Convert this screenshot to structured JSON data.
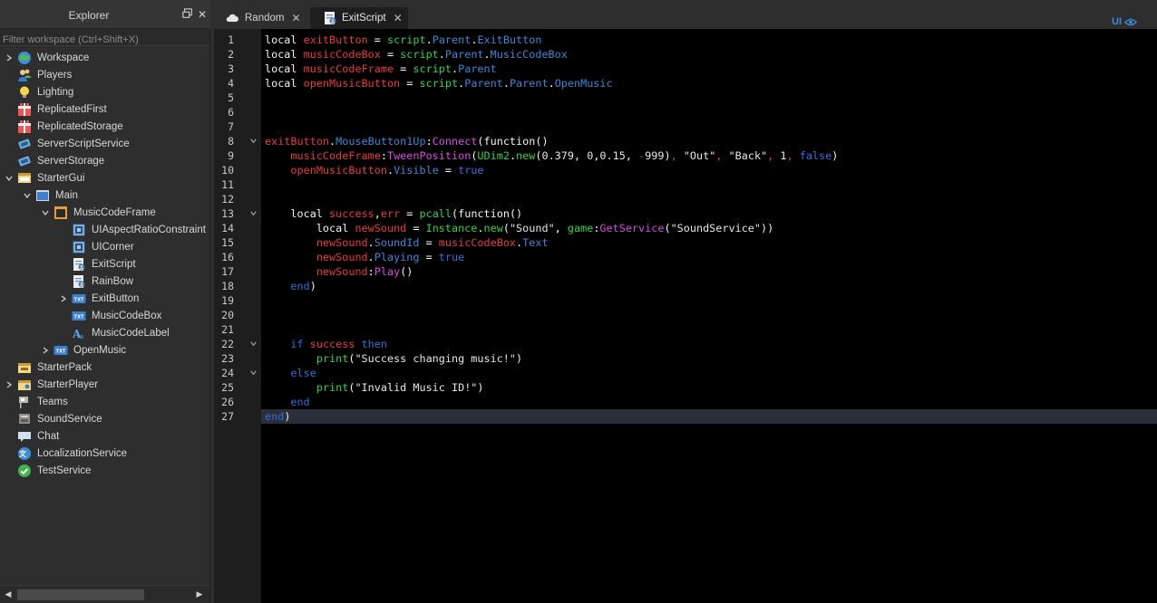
{
  "explorer": {
    "title": "Explorer",
    "filter_placeholder": "Filter workspace (Ctrl+Shift+X)",
    "nodes": [
      {
        "label": "Workspace",
        "icon": "workspace-icon",
        "has_chevron": true,
        "expanded": false
      },
      {
        "label": "Players",
        "icon": "players-icon"
      },
      {
        "label": "Lighting",
        "icon": "lightbulb-icon"
      },
      {
        "label": "ReplicatedFirst",
        "icon": "replicated-first-icon"
      },
      {
        "label": "ReplicatedStorage",
        "icon": "replicated-storage-icon"
      },
      {
        "label": "ServerScriptService",
        "icon": "server-script-service-icon"
      },
      {
        "label": "ServerStorage",
        "icon": "server-storage-icon"
      },
      {
        "label": "StarterGui",
        "icon": "starter-gui-icon",
        "has_chevron": true,
        "expanded": true
      },
      {
        "label": "Main",
        "icon": "screen-gui-icon",
        "has_chevron": true,
        "expanded": true
      },
      {
        "label": "MusicCodeFrame",
        "icon": "frame-icon",
        "has_chevron": true,
        "expanded": true
      },
      {
        "label": "UIAspectRatioConstraint",
        "icon": "ui-component-icon"
      },
      {
        "label": "UICorner",
        "icon": "ui-component-icon"
      },
      {
        "label": "ExitScript",
        "icon": "local-script-icon"
      },
      {
        "label": "RainBow",
        "icon": "local-script-icon"
      },
      {
        "label": "ExitButton",
        "icon": "text-button-icon",
        "has_chevron": true,
        "expanded": false
      },
      {
        "label": "MusicCodeBox",
        "icon": "text-box-icon"
      },
      {
        "label": "MusicCodeLabel",
        "icon": "text-label-icon"
      },
      {
        "label": "OpenMusic",
        "icon": "text-button-icon",
        "has_chevron": true,
        "expanded": false
      },
      {
        "label": "StarterPack",
        "icon": "starter-pack-icon"
      },
      {
        "label": "StarterPlayer",
        "icon": "starter-player-icon",
        "has_chevron": true,
        "expanded": false
      },
      {
        "label": "Teams",
        "icon": "teams-icon"
      },
      {
        "label": "SoundService",
        "icon": "sound-service-icon"
      },
      {
        "label": "Chat",
        "icon": "chat-icon"
      },
      {
        "label": "LocalizationService",
        "icon": "localization-icon"
      },
      {
        "label": "TestService",
        "icon": "check-icon"
      }
    ]
  },
  "tabs": [
    {
      "label": "Random",
      "icon": "cloud-icon",
      "active": false
    },
    {
      "label": "ExitScript",
      "icon": "local-script-icon",
      "active": true
    }
  ],
  "ui_toggle": {
    "label": "UI"
  },
  "editor": {
    "current_line": 27,
    "lines": [
      {
        "n": "1",
        "fold": false,
        "tokens": [
          [
            "kw",
            "local "
          ],
          [
            "var",
            "exitButton"
          ],
          [
            "tok-o",
            " = "
          ],
          [
            "gl",
            "script"
          ],
          [
            "tok-o",
            "."
          ],
          [
            "prop",
            "Parent"
          ],
          [
            "tok-o",
            "."
          ],
          [
            "prop",
            "ExitButton"
          ]
        ]
      },
      {
        "n": "2",
        "fold": false,
        "tokens": [
          [
            "kw",
            "local "
          ],
          [
            "var",
            "musicCodeBox"
          ],
          [
            "tok-o",
            " = "
          ],
          [
            "gl",
            "script"
          ],
          [
            "tok-o",
            "."
          ],
          [
            "prop",
            "Parent"
          ],
          [
            "tok-o",
            "."
          ],
          [
            "prop",
            "MusicCodeBox"
          ]
        ]
      },
      {
        "n": "3",
        "fold": false,
        "tokens": [
          [
            "kw",
            "local "
          ],
          [
            "var",
            "musicCodeFrame"
          ],
          [
            "tok-o",
            " = "
          ],
          [
            "gl",
            "script"
          ],
          [
            "tok-o",
            "."
          ],
          [
            "prop",
            "Parent"
          ]
        ]
      },
      {
        "n": "4",
        "fold": false,
        "tokens": [
          [
            "kw",
            "local "
          ],
          [
            "var",
            "openMusicButton"
          ],
          [
            "tok-o",
            " = "
          ],
          [
            "gl",
            "script"
          ],
          [
            "tok-o",
            "."
          ],
          [
            "prop",
            "Parent"
          ],
          [
            "tok-o",
            "."
          ],
          [
            "prop",
            "Parent"
          ],
          [
            "tok-o",
            "."
          ],
          [
            "prop",
            "OpenMusic"
          ]
        ]
      },
      {
        "n": "5",
        "fold": false,
        "tokens": []
      },
      {
        "n": "6",
        "fold": false,
        "tokens": []
      },
      {
        "n": "7",
        "fold": false,
        "tokens": []
      },
      {
        "n": "8",
        "fold": true,
        "tokens": [
          [
            "var",
            "exitButton"
          ],
          [
            "tok-o",
            "."
          ],
          [
            "prop",
            "MouseButton1Up"
          ],
          [
            "tok-o",
            ":"
          ],
          [
            "fn",
            "Connect"
          ],
          [
            "kw",
            "("
          ],
          [
            "kw",
            "function"
          ],
          [
            "kw",
            "()"
          ]
        ]
      },
      {
        "n": "9",
        "fold": false,
        "tokens": [
          [
            "tok-o",
            "    "
          ],
          [
            "var",
            "musicCodeFrame"
          ],
          [
            "tok-o",
            ":"
          ],
          [
            "fn",
            "TweenPosition"
          ],
          [
            "kw",
            "("
          ],
          [
            "gl",
            "UDim2"
          ],
          [
            "tok-o",
            "."
          ],
          [
            "gl",
            "new"
          ],
          [
            "kw",
            "("
          ],
          [
            "num",
            "0.379"
          ],
          [
            "tok-o",
            ", "
          ],
          [
            "num",
            "0"
          ],
          [
            "tok-o",
            ","
          ],
          [
            "num",
            "0.15"
          ],
          [
            "tok-o",
            ", "
          ],
          [
            "var",
            "-"
          ],
          [
            "num",
            "999"
          ],
          [
            "kw",
            ")"
          ],
          [
            "var",
            ", "
          ],
          [
            "str",
            "\"Out\""
          ],
          [
            "var",
            ", "
          ],
          [
            "str",
            "\"Back\""
          ],
          [
            "var",
            ", "
          ],
          [
            "num",
            "1"
          ],
          [
            "var",
            ", "
          ],
          [
            "bool",
            "false"
          ],
          [
            "kw",
            ")"
          ]
        ]
      },
      {
        "n": "10",
        "fold": false,
        "tokens": [
          [
            "tok-o",
            "    "
          ],
          [
            "var",
            "openMusicButton"
          ],
          [
            "tok-o",
            "."
          ],
          [
            "prop",
            "Visible"
          ],
          [
            "tok-o",
            " = "
          ],
          [
            "bool",
            "true"
          ]
        ]
      },
      {
        "n": "11",
        "fold": false,
        "tokens": []
      },
      {
        "n": "12",
        "fold": false,
        "tokens": []
      },
      {
        "n": "13",
        "fold": true,
        "tokens": [
          [
            "tok-o",
            "    "
          ],
          [
            "kw",
            "local "
          ],
          [
            "var",
            "success"
          ],
          [
            "tok-o",
            ","
          ],
          [
            "var",
            "err"
          ],
          [
            "tok-o",
            " = "
          ],
          [
            "gl",
            "pcall"
          ],
          [
            "kw",
            "("
          ],
          [
            "kw",
            "function"
          ],
          [
            "kw",
            "()"
          ]
        ]
      },
      {
        "n": "14",
        "fold": false,
        "tokens": [
          [
            "tok-o",
            "        "
          ],
          [
            "kw",
            "local "
          ],
          [
            "var",
            "newSound"
          ],
          [
            "tok-o",
            " = "
          ],
          [
            "gl",
            "Instance"
          ],
          [
            "tok-o",
            "."
          ],
          [
            "gl",
            "new"
          ],
          [
            "kw",
            "("
          ],
          [
            "str",
            "\"Sound\""
          ],
          [
            "tok-o",
            ", "
          ],
          [
            "gl",
            "game"
          ],
          [
            "tok-o",
            ":"
          ],
          [
            "fn",
            "GetService"
          ],
          [
            "kw",
            "("
          ],
          [
            "str",
            "\"SoundService\""
          ],
          [
            "kw",
            "))"
          ]
        ]
      },
      {
        "n": "15",
        "fold": false,
        "tokens": [
          [
            "tok-o",
            "        "
          ],
          [
            "var",
            "newSound"
          ],
          [
            "tok-o",
            "."
          ],
          [
            "prop",
            "SoundId"
          ],
          [
            "tok-o",
            " = "
          ],
          [
            "var",
            "musicCodeBox"
          ],
          [
            "tok-o",
            "."
          ],
          [
            "prop",
            "Text"
          ]
        ]
      },
      {
        "n": "16",
        "fold": false,
        "tokens": [
          [
            "tok-o",
            "        "
          ],
          [
            "var",
            "newSound"
          ],
          [
            "tok-o",
            "."
          ],
          [
            "prop",
            "Playing"
          ],
          [
            "tok-o",
            " = "
          ],
          [
            "bool",
            "true"
          ]
        ]
      },
      {
        "n": "17",
        "fold": false,
        "tokens": [
          [
            "tok-o",
            "        "
          ],
          [
            "var",
            "newSound"
          ],
          [
            "tok-o",
            ":"
          ],
          [
            "fn",
            "Play"
          ],
          [
            "kw",
            "()"
          ]
        ]
      },
      {
        "n": "18",
        "fold": false,
        "tokens": [
          [
            "tok-o",
            "    "
          ],
          [
            "kb",
            "end"
          ],
          [
            "kw",
            ")"
          ]
        ]
      },
      {
        "n": "19",
        "fold": false,
        "tokens": []
      },
      {
        "n": "20",
        "fold": false,
        "tokens": []
      },
      {
        "n": "21",
        "fold": false,
        "tokens": []
      },
      {
        "n": "22",
        "fold": true,
        "tokens": [
          [
            "tok-o",
            "    "
          ],
          [
            "kb",
            "if "
          ],
          [
            "var",
            "success "
          ],
          [
            "kb",
            "then"
          ]
        ]
      },
      {
        "n": "23",
        "fold": false,
        "tokens": [
          [
            "tok-o",
            "        "
          ],
          [
            "gl",
            "print"
          ],
          [
            "kw",
            "("
          ],
          [
            "str",
            "\"Success changing music!\""
          ],
          [
            "kw",
            ")"
          ]
        ]
      },
      {
        "n": "24",
        "fold": true,
        "tokens": [
          [
            "tok-o",
            "    "
          ],
          [
            "kb",
            "else"
          ]
        ]
      },
      {
        "n": "25",
        "fold": false,
        "tokens": [
          [
            "tok-o",
            "        "
          ],
          [
            "gl",
            "print"
          ],
          [
            "kw",
            "("
          ],
          [
            "str",
            "\"Invalid Music ID!\""
          ],
          [
            "kw",
            ")"
          ]
        ]
      },
      {
        "n": "26",
        "fold": false,
        "tokens": [
          [
            "tok-o",
            "    "
          ],
          [
            "kb",
            "end"
          ]
        ]
      },
      {
        "n": "27",
        "fold": false,
        "tokens": [
          [
            "kb",
            "end"
          ],
          [
            "kw",
            ")"
          ]
        ]
      }
    ]
  },
  "colors": {
    "keyword": "#2f6ed8",
    "variable": "#e63b3b",
    "builtin": "#36d14a",
    "property": "#3f86d4",
    "method": "#d64be0",
    "background": "#000000"
  }
}
